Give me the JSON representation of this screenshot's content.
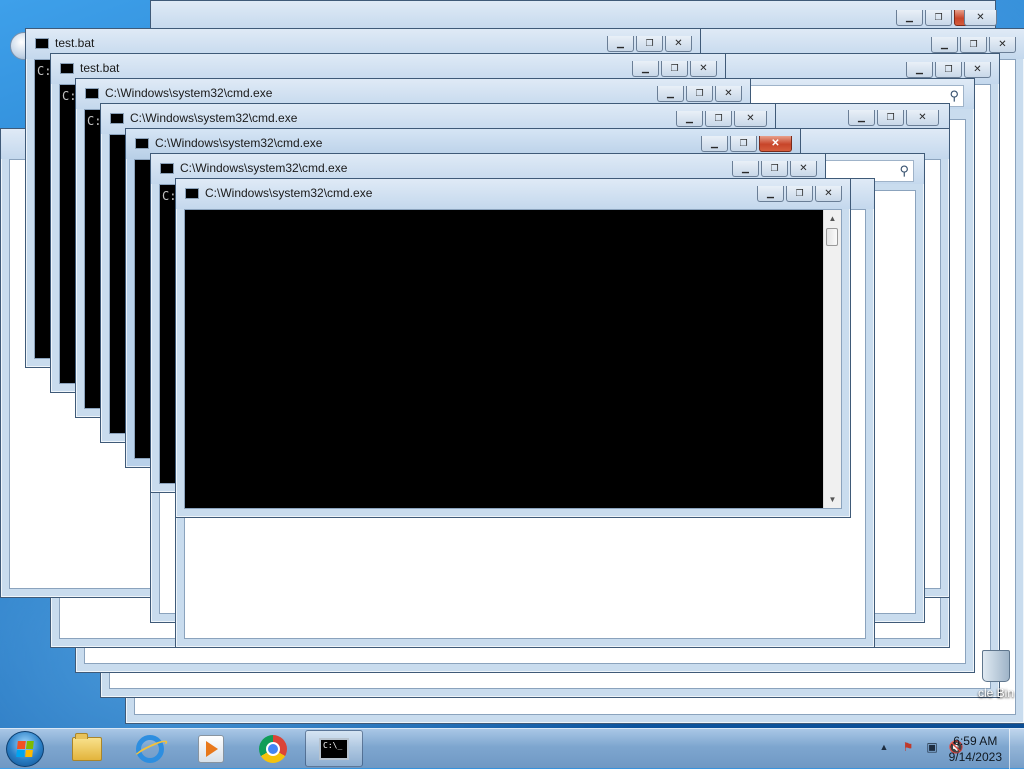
{
  "desktop": {
    "recycle_bin_label": "cle Bin"
  },
  "windows": {
    "test_bat_1": {
      "title": "test.bat",
      "prompt": "C:"
    },
    "test_bat_2": {
      "title": "test.bat",
      "prompt": "C:"
    },
    "cmd_1": {
      "title": "C:\\Windows\\system32\\cmd.exe",
      "prompt": "C:"
    },
    "cmd_2": {
      "title": "C:\\Windows\\system32\\cmd.exe"
    },
    "cmd_3": {
      "title": "C:\\Windows\\system32\\cmd.exe"
    },
    "cmd_4": {
      "title": "C:\\Windows\\system32\\cmd.exe",
      "prompt": "C:"
    },
    "cmd_5": {
      "title": "C:\\Windows\\system32\\cmd.exe"
    }
  },
  "window_controls": {
    "minimize": "▁",
    "maximize": "❐",
    "close": "✕"
  },
  "scrollbar": {
    "up": "▲",
    "down": "▼"
  },
  "search_icon": "⚲",
  "taskbar": {
    "clock_time": "6:59 AM",
    "clock_date": "9/14/2023",
    "cmd_icon_text": "C:\\_",
    "tray_arrow": "▲",
    "tray_flag": "⚑",
    "tray_network": "▣",
    "tray_volume": "🔇"
  },
  "colors": {
    "close_button": "#c8452a",
    "console_bg": "#000000",
    "taskbar": "#7ea6cf"
  }
}
